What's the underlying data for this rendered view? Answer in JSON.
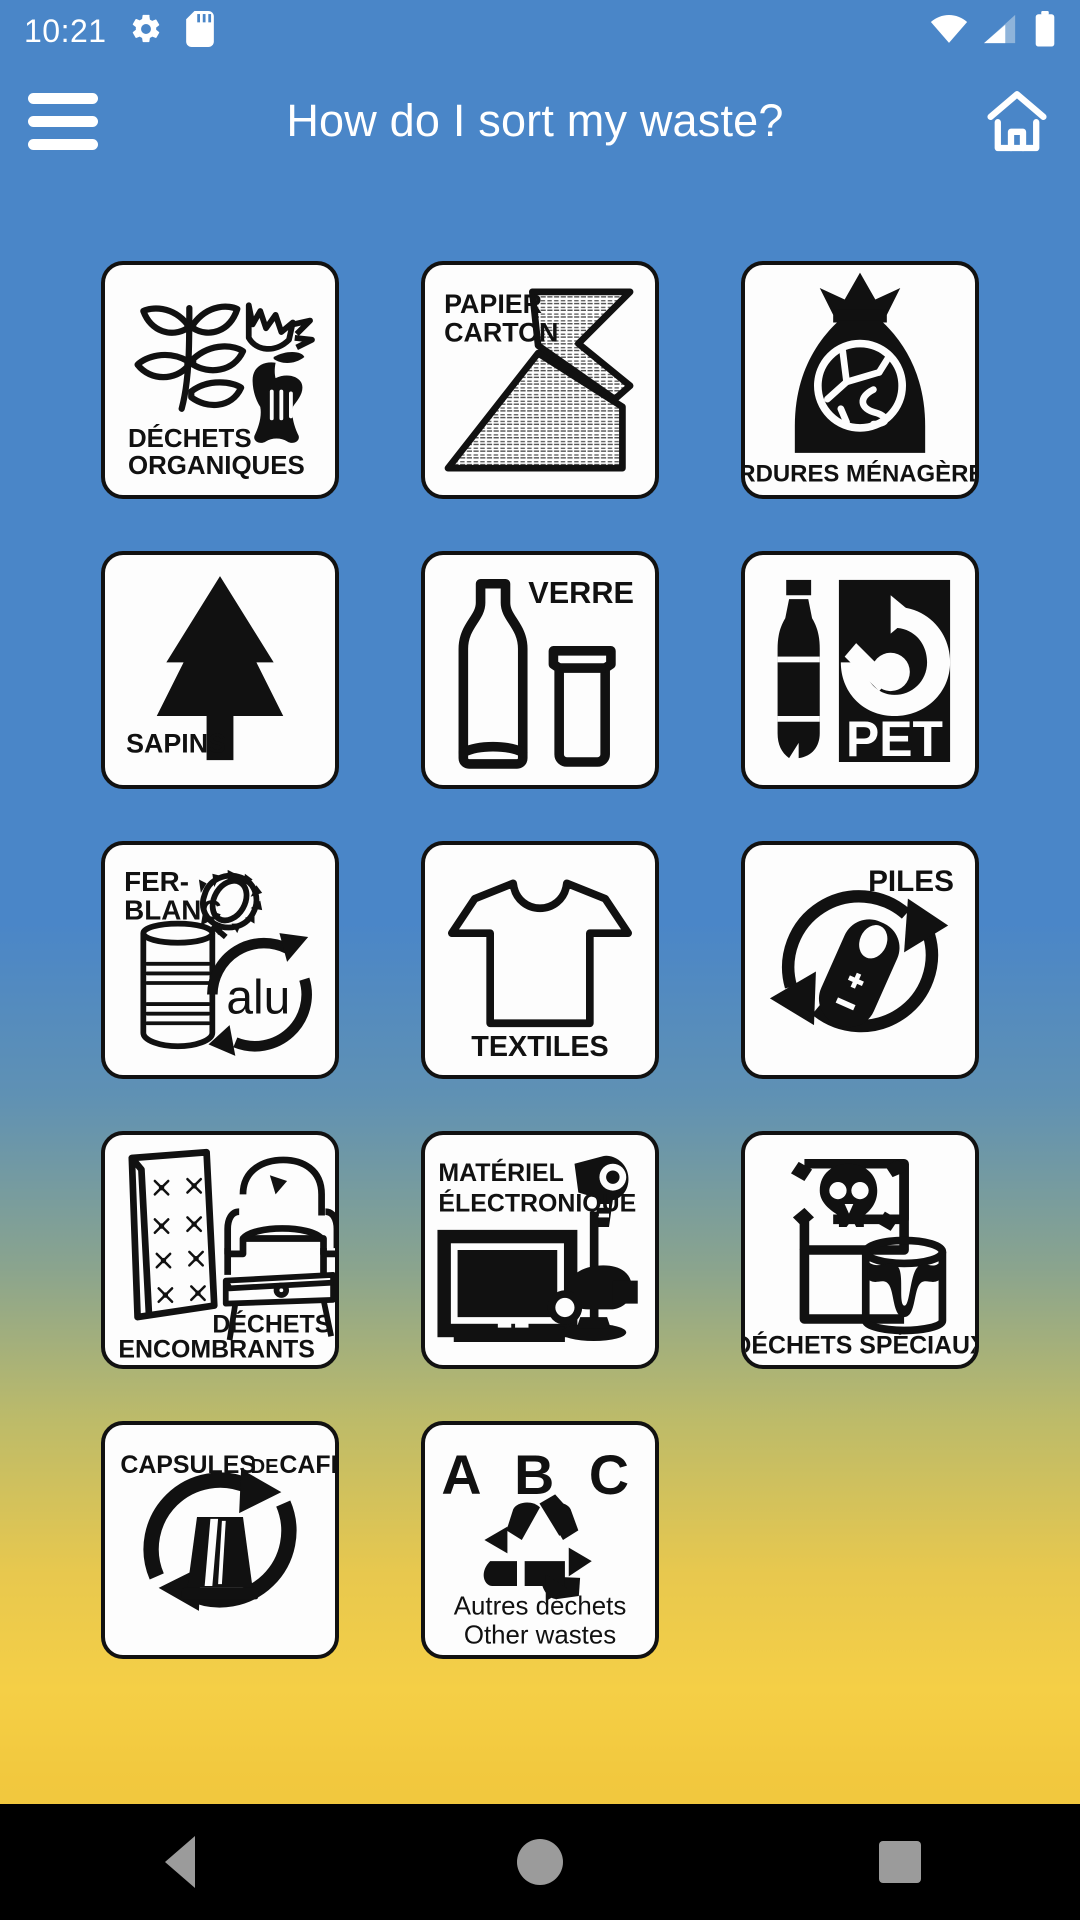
{
  "statusbar": {
    "time": "10:21",
    "icons_left": [
      "gear-icon",
      "sd-card-icon"
    ],
    "icons_right": [
      "wifi-icon",
      "cellular-signal-icon",
      "battery-icon"
    ]
  },
  "appbar": {
    "menu_icon": "hamburger-menu-icon",
    "title": "How do I sort my waste?",
    "home_icon": "home-icon",
    "background_color": "#4a86c8",
    "text_color": "#ffffff"
  },
  "grid": {
    "tiles": [
      {
        "id": "dechets-organiques",
        "label_lines": [
          "DÉCHETS",
          "ORGANIQUES"
        ],
        "icon": "organic-waste-icon"
      },
      {
        "id": "papier-carton",
        "label_lines": [
          "PAPIER",
          "CARTON"
        ],
        "icon": "paper-cardboard-icon"
      },
      {
        "id": "ordures-menageres",
        "label_lines": [
          "ORDURES MÉNAGÈRES"
        ],
        "icon": "garbage-bag-icon"
      },
      {
        "id": "sapins",
        "label_lines": [
          "SAPINS"
        ],
        "icon": "fir-tree-icon"
      },
      {
        "id": "verre",
        "label_lines": [
          "VERRE"
        ],
        "icon": "glass-bottle-jar-icon"
      },
      {
        "id": "pet",
        "label_lines": [
          "PET"
        ],
        "icon": "pet-bottle-recycling-icon"
      },
      {
        "id": "fer-blanc",
        "label_lines": [
          "FER-",
          "BLANC",
          "alu"
        ],
        "icon": "tin-can-alu-icon"
      },
      {
        "id": "textiles",
        "label_lines": [
          "TEXTILES"
        ],
        "icon": "tshirt-icon"
      },
      {
        "id": "piles",
        "label_lines": [
          "PILES"
        ],
        "icon": "battery-recycling-icon"
      },
      {
        "id": "dechets-encombrants",
        "label_lines": [
          "DÉCHETS",
          "ENCOMBRANTS"
        ],
        "icon": "bulky-waste-furniture-icon"
      },
      {
        "id": "materiel-electronique",
        "label_lines": [
          "MATÉRIEL",
          "ÉLECTRONIQUE"
        ],
        "icon": "electronic-equipment-icon"
      },
      {
        "id": "dechets-speciaux",
        "label_lines": [
          "DÉCHETS SPÉCIAUX"
        ],
        "icon": "hazardous-waste-icon"
      },
      {
        "id": "capsules-de-cafe",
        "label_lines": [
          "CAPSULES DE CAFÉ"
        ],
        "icon": "coffee-capsule-recycling-icon"
      },
      {
        "id": "abc-autres-dechets",
        "label_lines": [
          "A B C",
          "Autres déchets",
          "Other wastes"
        ],
        "icon": "recycling-triangle-icon"
      }
    ]
  },
  "navbar": {
    "back_label": "Back",
    "home_label": "Home",
    "recents_label": "Recents",
    "background_color": "#000000",
    "icon_color": "#9b9b9b"
  },
  "labels": {
    "t0_l1": "DÉCHETS",
    "t0_l2": "ORGANIQUES",
    "t1_l1": "PAPIER",
    "t1_l2": "CARTON",
    "t2_l1": "ORDURES MÉNAGÈRES",
    "t3_l1": "SAPINS",
    "t4_l1": "VERRE",
    "t5_l1": "PET",
    "t6_l1": "FER-",
    "t6_l2": "BLANC",
    "t6_l3": "alu",
    "t7_l1": "TEXTILES",
    "t8_l1": "PILES",
    "t9_l1": "DÉCHETS",
    "t9_l2": "ENCOMBRANTS",
    "t10_l1": "MATÉRIEL",
    "t10_l2": "ÉLECTRONIQUE",
    "t11_l1": "DÉCHETS SPÉCIAUX",
    "t12_l1": "CAPSULES",
    "t12_l2": "DE",
    "t12_l3": "CAFÉ",
    "t13_l1": "A B C",
    "t13_l2": "Autres déchets",
    "t13_l3": "Other wastes"
  }
}
